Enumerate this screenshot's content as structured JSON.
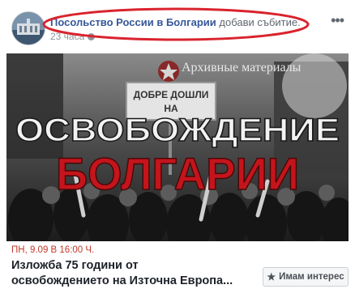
{
  "post": {
    "author": "Посольство России в Болгарии",
    "action": "добави събитие.",
    "time": "23 часа"
  },
  "cover": {
    "banner": "Архивные материалы",
    "sign_line1": "ДОБРЕ ДОШЛИ",
    "sign_line2": "НА",
    "title_line1": "ОСВОБОЖДЕНИЕ",
    "title_line2": "БОЛГАРИИ"
  },
  "event": {
    "date": "ПН, 9.09 В 16:00 Ч.",
    "title_line1": "Изложба 75 години от",
    "title_line2": "освобождението на Източна Европа..."
  },
  "interest_button": {
    "label": "Имам интерес"
  },
  "colors": {
    "link": "#365899",
    "date": "#c0392b",
    "highlight": "#d9232d",
    "title_red": "#c4151c"
  }
}
